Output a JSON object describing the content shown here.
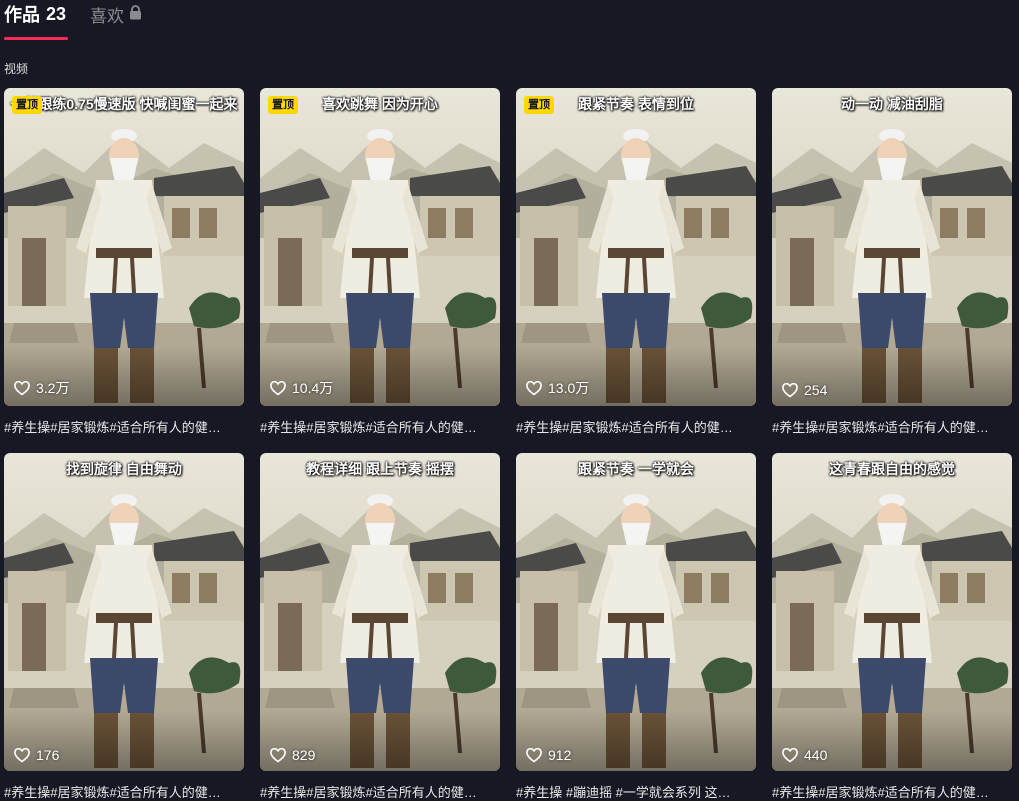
{
  "tabs": {
    "works_label": "作品",
    "works_count": "23",
    "likes_label": "喜欢",
    "likes_icon": "lock-icon"
  },
  "section_label": "视频",
  "colors": {
    "background": "#161823",
    "accent": "#fe2c55",
    "pin_badge": "#ffd700"
  },
  "videos": [
    {
      "overlay": "一起跟练0.75慢速版 快喊闺蜜一起来",
      "pinned": true,
      "pin_label": "置顶",
      "likes": "3.2万",
      "caption": "#养生操#居家锻炼#适合所有人的健…"
    },
    {
      "overlay": "喜欢跳舞 因为开心",
      "pinned": true,
      "pin_label": "置顶",
      "likes": "10.4万",
      "caption": "#养生操#居家锻炼#适合所有人的健…"
    },
    {
      "overlay": "跟紧节奏 表情到位",
      "pinned": true,
      "pin_label": "置顶",
      "likes": "13.0万",
      "caption": "#养生操#居家锻炼#适合所有人的健…"
    },
    {
      "overlay": "动一动 减油刮脂",
      "pinned": false,
      "pin_label": "",
      "likes": "254",
      "caption": "#养生操#居家锻炼#适合所有人的健…"
    },
    {
      "overlay": "找到旋律 自由舞动",
      "pinned": false,
      "pin_label": "",
      "likes": "176",
      "caption": "#养生操#居家锻炼#适合所有人的健…"
    },
    {
      "overlay": "教程详细 跟上节奏 摇摆",
      "pinned": false,
      "pin_label": "",
      "likes": "829",
      "caption": "#养生操#居家锻炼#适合所有人的健…"
    },
    {
      "overlay": "跟紧节奏 一学就会",
      "pinned": false,
      "pin_label": "",
      "likes": "912",
      "caption": "#养生操 #蹦迪摇 #一学就会系列 这…"
    },
    {
      "overlay": "这青春跟自由的感觉",
      "pinned": false,
      "pin_label": "",
      "likes": "440",
      "caption": "#养生操#居家锻炼#适合所有人的健…"
    }
  ]
}
